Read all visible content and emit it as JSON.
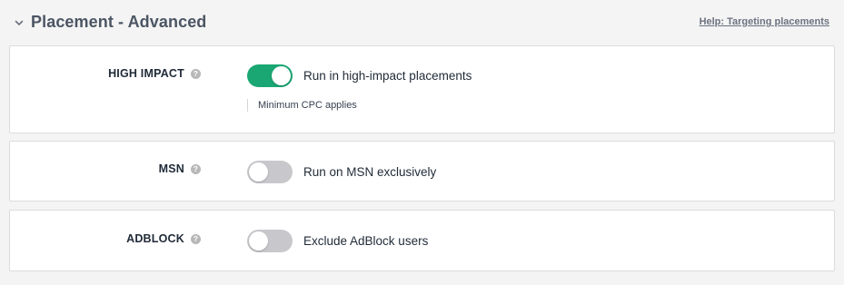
{
  "section": {
    "title": "Placement - Advanced",
    "help_link": "Help: Targeting placements",
    "collapse_icon": "chevron-down-icon"
  },
  "rows": [
    {
      "label": "HIGH IMPACT",
      "help_icon": "?",
      "toggle_on": true,
      "toggle_label": "Run in high-impact placements",
      "note": "Minimum CPC applies"
    },
    {
      "label": "MSN",
      "help_icon": "?",
      "toggle_on": false,
      "toggle_label": "Run on MSN exclusively"
    },
    {
      "label": "ADBLOCK",
      "help_icon": "?",
      "toggle_on": false,
      "toggle_label": "Exclude AdBlock users"
    }
  ],
  "colors": {
    "toggle_on": "#1aa773",
    "toggle_off": "#c8c8cc",
    "page_bg": "#f4f4f4",
    "card_bg": "#ffffff"
  }
}
